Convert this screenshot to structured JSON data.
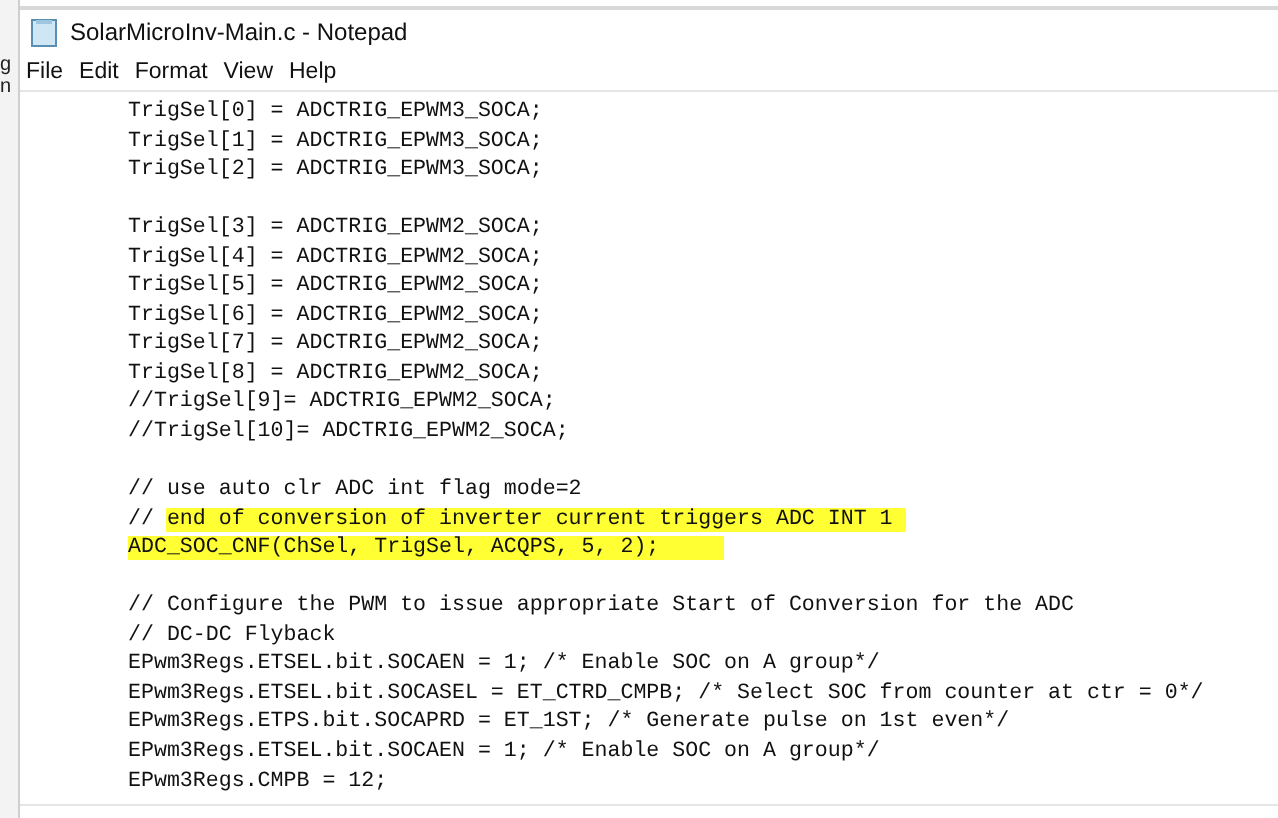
{
  "background_window": {
    "texts": [
      "g",
      "n"
    ]
  },
  "window": {
    "title": "SolarMicroInv-Main.c - Notepad"
  },
  "menu": [
    "File",
    "Edit",
    "Format",
    "View",
    "Help"
  ],
  "editor": {
    "lines": [
      {
        "segments": [
          {
            "text": "TrigSel[0] = ADCTRIG_EPWM3_SOCA;",
            "highlighted": false
          }
        ]
      },
      {
        "segments": [
          {
            "text": "TrigSel[1] = ADCTRIG_EPWM3_SOCA;",
            "highlighted": false
          }
        ]
      },
      {
        "segments": [
          {
            "text": "TrigSel[2] = ADCTRIG_EPWM3_SOCA;",
            "highlighted": false
          }
        ]
      },
      {
        "blank_line_before": true,
        "segments": [
          {
            "text": "TrigSel[3] = ADCTRIG_EPWM2_SOCA;",
            "highlighted": false
          }
        ]
      },
      {
        "segments": [
          {
            "text": "TrigSel[4] = ADCTRIG_EPWM2_SOCA;",
            "highlighted": false
          }
        ]
      },
      {
        "segments": [
          {
            "text": "TrigSel[5] = ADCTRIG_EPWM2_SOCA;",
            "highlighted": false
          }
        ]
      },
      {
        "segments": [
          {
            "text": "TrigSel[6] = ADCTRIG_EPWM2_SOCA;",
            "highlighted": false
          }
        ]
      },
      {
        "segments": [
          {
            "text": "TrigSel[7] = ADCTRIG_EPWM2_SOCA;",
            "highlighted": false
          }
        ]
      },
      {
        "segments": [
          {
            "text": "TrigSel[8] = ADCTRIG_EPWM2_SOCA;",
            "highlighted": false
          }
        ]
      },
      {
        "segments": [
          {
            "text": "//TrigSel[9]= ADCTRIG_EPWM2_SOCA;",
            "highlighted": false
          }
        ]
      },
      {
        "segments": [
          {
            "text": "//TrigSel[10]= ADCTRIG_EPWM2_SOCA;",
            "highlighted": false
          }
        ]
      },
      {
        "blank_line_before": true,
        "segments": [
          {
            "text": "// use auto clr ADC int flag mode=2",
            "highlighted": false
          }
        ]
      },
      {
        "segments": [
          {
            "text": "// ",
            "highlighted": false
          },
          {
            "text": "end of conversion of inverter current triggers ADC INT 1 ",
            "highlighted": true
          }
        ]
      },
      {
        "segments": [
          {
            "text": "ADC_SOC_CNF(ChSel, TrigSel, ACQPS, 5, 2);     ",
            "highlighted": true
          }
        ]
      },
      {
        "blank_line_before": true,
        "segments": [
          {
            "text": "// Configure the PWM to issue appropriate Start of Conversion for the ADC",
            "highlighted": false
          }
        ]
      },
      {
        "segments": [
          {
            "text": "// DC-DC Flyback",
            "highlighted": false
          }
        ]
      },
      {
        "segments": [
          {
            "text": "EPwm3Regs.ETSEL.bit.SOCAEN = 1; /* Enable SOC on A group*/",
            "highlighted": false
          }
        ]
      },
      {
        "segments": [
          {
            "text": "EPwm3Regs.ETSEL.bit.SOCASEL = ET_CTRD_CMPB; /* Select SOC from counter at ctr = 0*/",
            "highlighted": false
          }
        ]
      },
      {
        "segments": [
          {
            "text": "EPwm3Regs.ETPS.bit.SOCAPRD = ET_1ST; /* Generate pulse on 1st even*/",
            "highlighted": false
          }
        ]
      },
      {
        "segments": [
          {
            "text": "EPwm3Regs.ETSEL.bit.SOCAEN = 1; /* Enable SOC on A group*/",
            "highlighted": false
          }
        ]
      },
      {
        "segments": [
          {
            "text": "EPwm3Regs.CMPB = 12;",
            "highlighted": false
          }
        ]
      }
    ]
  }
}
